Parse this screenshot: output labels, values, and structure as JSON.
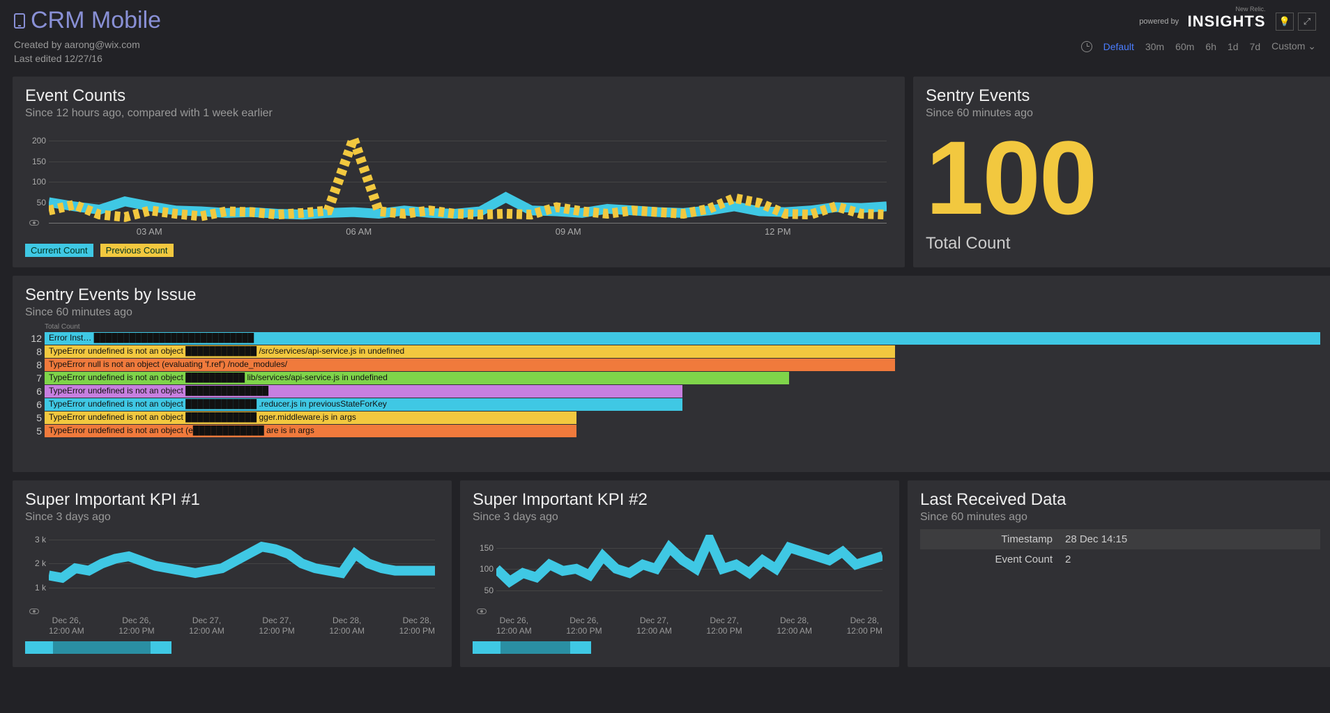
{
  "header": {
    "title": "CRM Mobile",
    "created_by_label": "Created by aarong@wix.com",
    "last_edited_label": "Last edited 12/27/16",
    "powered_by": "powered by",
    "brand_small": "New Relic.",
    "brand": "INSIGHTS",
    "time_options": [
      "Default",
      "30m",
      "60m",
      "6h",
      "1d",
      "7d",
      "Custom"
    ],
    "active_time": "Default"
  },
  "event_counts": {
    "title": "Event Counts",
    "subtitle": "Since 12 hours ago, compared with 1 week earlier",
    "legend_current": "Current Count",
    "legend_previous": "Previous Count"
  },
  "sentry_counter": {
    "title": "Sentry Events",
    "subtitle": "Since 60 minutes ago",
    "value": "100",
    "label": "Total Count"
  },
  "sentry_issues": {
    "title": "Sentry Events by Issue",
    "subtitle": "Since 60 minutes ago",
    "axis_label": "Total Count"
  },
  "kpi1": {
    "title": "Super Important KPI #1",
    "subtitle": "Since 3 days ago"
  },
  "kpi2": {
    "title": "Super Important KPI #2",
    "subtitle": "Since 3 days ago"
  },
  "last_received": {
    "title": "Last Received Data",
    "subtitle": "Since 60 minutes ago",
    "rows": [
      {
        "k": "Timestamp",
        "v": "28 Dec 14:15"
      },
      {
        "k": "Event Count",
        "v": "2"
      }
    ]
  },
  "chart_data": [
    {
      "id": "event_counts",
      "type": "line",
      "title": "Event Counts",
      "xlabel": "",
      "ylabel": "",
      "ylim": [
        0,
        220
      ],
      "y_ticks": [
        50,
        100,
        150,
        200
      ],
      "x_ticks": [
        "03 AM",
        "06 AM",
        "09 AM",
        "12 PM"
      ],
      "series": [
        {
          "name": "Current Count",
          "color": "#3fc8e4",
          "values": [
            50,
            40,
            32,
            52,
            40,
            30,
            28,
            24,
            26,
            22,
            20,
            24,
            26,
            22,
            30,
            24,
            22,
            28,
            62,
            30,
            28,
            24,
            34,
            30,
            26,
            24,
            30,
            40,
            28,
            26,
            30,
            38,
            36,
            40
          ]
        },
        {
          "name": "Previous Count",
          "color": "#f2c83f",
          "dashed": true,
          "values": [
            30,
            44,
            20,
            14,
            30,
            22,
            16,
            28,
            26,
            20,
            24,
            30,
            205,
            28,
            22,
            30,
            22,
            20,
            22,
            20,
            38,
            28,
            22,
            30,
            26,
            22,
            34,
            60,
            48,
            22,
            20,
            40,
            22,
            20
          ]
        }
      ]
    },
    {
      "id": "sentry_issues",
      "type": "bar",
      "orientation": "horizontal",
      "title": "Sentry Events by Issue",
      "xlabel": "Total Count",
      "ylabel": "",
      "categories": [
        "Error Inst… ███████████████████████████",
        "TypeError undefined is not an object ████████████ /src/services/api-service.js in undefined",
        "TypeError null is not an object (evaluating 'f.ref') /node_modules/",
        "TypeError undefined is not an object ██████████ lib/services/api-service.js in undefined",
        "TypeError undefined is not an object ██████████████",
        "TypeError undefined is not an object ████████████ .reducer.js in previousStateForKey",
        "TypeError undefined is not an object ████████████ gger.middleware.js in args",
        "TypeError undefined is not an object (e████████████ are is in args"
      ],
      "values": [
        12,
        8,
        8,
        7,
        6,
        6,
        5,
        5
      ],
      "colors": [
        "#3fc8e4",
        "#f2c83f",
        "#f07a3c",
        "#7fd44a",
        "#c77fe0",
        "#3fc8e4",
        "#f2c83f",
        "#f07a3c"
      ]
    },
    {
      "id": "kpi1",
      "type": "line",
      "title": "Super Important KPI #1",
      "ylim": [
        0,
        3200
      ],
      "y_ticks": [
        "1 k",
        "2 k",
        "3 k"
      ],
      "x_ticks": [
        "Dec 26,\n12:00 AM",
        "Dec 26,\n12:00 PM",
        "Dec 27,\n12:00 AM",
        "Dec 27,\n12:00 PM",
        "Dec 28,\n12:00 AM",
        "Dec 28,\n12:00 PM"
      ],
      "series": [
        {
          "name": "series",
          "color": "#3fc8e4",
          "values": [
            1500,
            1400,
            1800,
            1700,
            2000,
            2200,
            2300,
            2100,
            1900,
            1800,
            1700,
            1600,
            1700,
            1800,
            2100,
            2400,
            2700,
            2600,
            2400,
            2000,
            1800,
            1700,
            1600,
            2400,
            2000,
            1800,
            1700,
            1700,
            1700,
            1700
          ]
        }
      ]
    },
    {
      "id": "kpi2",
      "type": "line",
      "title": "Super Important KPI #2",
      "ylim": [
        0,
        180
      ],
      "y_ticks": [
        50,
        100,
        150
      ],
      "x_ticks": [
        "Dec 26,\n12:00 AM",
        "Dec 26,\n12:00 PM",
        "Dec 27,\n12:00 AM",
        "Dec 27,\n12:00 PM",
        "Dec 28,\n12:00 AM",
        "Dec 28,\n12:00 PM"
      ],
      "series": [
        {
          "name": "series",
          "color": "#3fc8e4",
          "values": [
            100,
            70,
            90,
            80,
            110,
            95,
            100,
            85,
            130,
            100,
            90,
            110,
            100,
            150,
            120,
            100,
            170,
            100,
            110,
            90,
            120,
            100,
            150,
            140,
            130,
            120,
            140,
            110,
            120,
            130
          ]
        }
      ]
    }
  ]
}
